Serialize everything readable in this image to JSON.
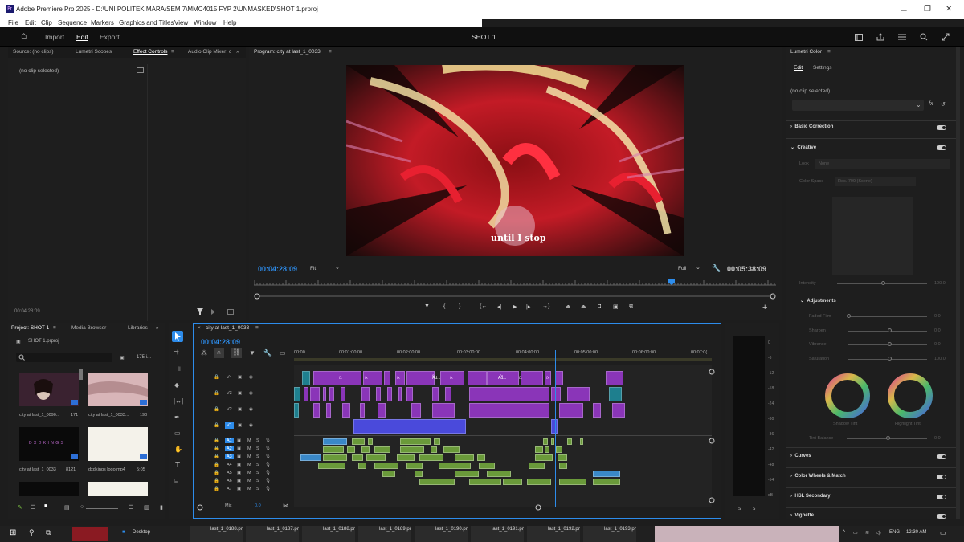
{
  "window": {
    "title": "Adobe Premiere Pro 2025 - D:\\UNI POLITEK MARA\\SEM 7\\MMC4015 FYP 2\\UNMASKED\\SHOT 1.prproj",
    "logo": "Pr",
    "controls": [
      "–",
      "❐",
      "✕"
    ]
  },
  "menu": [
    "File",
    "Edit",
    "Clip",
    "Sequence",
    "Markers",
    "Graphics and Titles",
    "View",
    "Window",
    "Help"
  ],
  "appbar": {
    "home": "⌂",
    "nav": [
      "Import",
      "Edit",
      "Export"
    ],
    "active_nav": "Edit",
    "sequence_title": "SHOT 1"
  },
  "source_panel": {
    "tabs": [
      "Source: (no clips)",
      "Lumetri Scopes",
      "Effect Controls",
      "Audio Clip Mixer: c",
      "»"
    ],
    "active_tab": "Effect Controls",
    "tab_menu": "≡",
    "no_clip": "(no clip selected)",
    "timecode": "00:04:28:09"
  },
  "program": {
    "title": "Program: city at last_1_0033",
    "menu": "≡",
    "subtitle": "until I stop",
    "timecode_in": "00:04:28:09",
    "fit": "Fit",
    "quality": "Full",
    "timecode_out": "00:05:38:09",
    "playhead_fraction": 0.8
  },
  "project": {
    "tabs": [
      "Project: SHOT 1",
      "Media Browser",
      "Libraries",
      "»"
    ],
    "file": "SHOT 1.prproj",
    "search_placeholder": "",
    "item_count": "175 i...",
    "items": [
      {
        "name": "city at last_1_0090...",
        "dur": "171"
      },
      {
        "name": "city at last_1_0033...",
        "dur": "190"
      },
      {
        "name": "city at last_1_0033",
        "dur": "8121"
      },
      {
        "name": "dxdkings logo.mp4",
        "dur": "5;05"
      }
    ],
    "logo_text": "D X D K I N G S"
  },
  "timeline": {
    "tab": "city at last_1_0033",
    "timecode": "00:04:28:09",
    "ruler": [
      "00:00",
      "00:01:00:00",
      "00:02:00:00",
      "00:03:00:00",
      "00:04:00:00",
      "00:05:00:00",
      "00:06:00:00",
      "00:07:0("
    ],
    "video_tracks": [
      "V4",
      "V3",
      "V2",
      "V1"
    ],
    "audio_tracks": [
      "A1",
      "A2",
      "A3",
      "A4",
      "A5",
      "A6",
      "A7"
    ],
    "mix": "Mix",
    "mix_value": "0.0",
    "fx_label": "fx",
    "ad_label": "Ad...",
    "track_m": "M",
    "track_s": "S"
  },
  "meter": {
    "scale": [
      "0",
      "-6",
      "-12",
      "-18",
      "-24",
      "-30",
      "-36",
      "-42",
      "-48",
      "-54",
      "dB"
    ],
    "footer": [
      "S",
      "S"
    ]
  },
  "lumetri": {
    "title": "Lumetri Color",
    "tabs": [
      "Edit",
      "Settings"
    ],
    "no_clip": "(no clip selected)",
    "sections": [
      "Basic Correction",
      "Creative",
      "Curves",
      "Color Wheels & Match",
      "HSL Secondary",
      "Vignette"
    ],
    "look_label": "Look",
    "look_value": "None",
    "color_space_label": "Color Space",
    "color_space_value": "Rec. 709 (Scene)",
    "intensity_label": "Intensity",
    "intensity_value": "100.0",
    "adjustments_label": "Adjustments",
    "adjustments": [
      {
        "label": "Faded Film",
        "value": "0.0"
      },
      {
        "label": "Sharpen",
        "value": "0.0"
      },
      {
        "label": "Vibrance",
        "value": "0.0"
      },
      {
        "label": "Saturation",
        "value": "100.0"
      }
    ],
    "shadow_tint": "Shadow Tint",
    "highlight_tint": "Highlight Tint",
    "tint_balance_label": "Tint Balance",
    "tint_balance_value": "0.0"
  },
  "taskbar": {
    "desktop": "Desktop",
    "files": [
      "last_1_0188.png",
      "last_1_0187.png",
      "last_1_0188.png",
      "last_1_0189.png",
      "last_1_0190.png",
      "last_1_0191.png",
      "last_1_0192.png",
      "last_1_0193.png"
    ],
    "lang": "ENG",
    "time": "12:30 AM"
  },
  "colors": {
    "accent": "#2d8ceb",
    "clip_purple": "#8a35b8",
    "clip_blue": "#4a4adb",
    "clip_teal": "#1e7f8e",
    "clip_green": "#6a9a3a",
    "clip_audio_blue": "#3a88c8"
  }
}
